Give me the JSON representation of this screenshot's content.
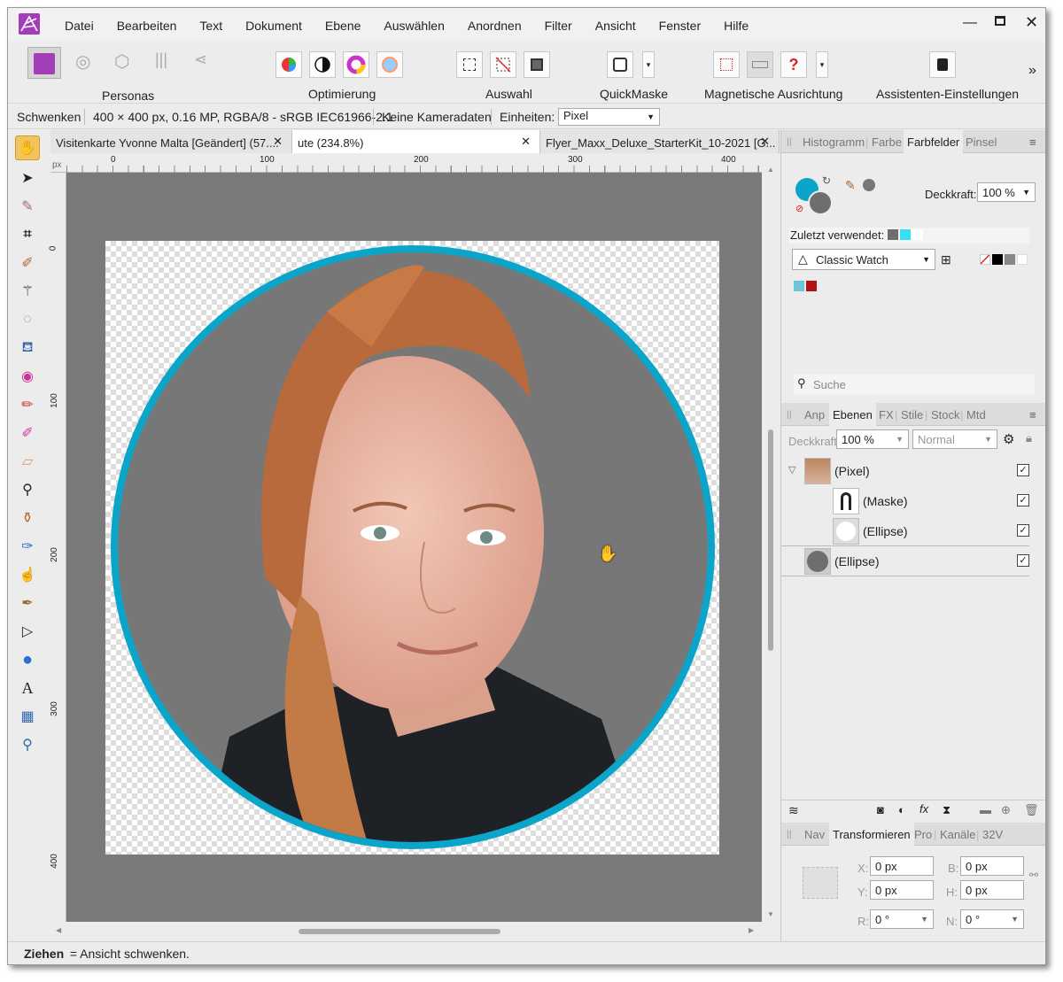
{
  "menu": [
    "Datei",
    "Bearbeiten",
    "Text",
    "Dokument",
    "Ebene",
    "Auswählen",
    "Anordnen",
    "Filter",
    "Ansicht",
    "Fenster",
    "Hilfe"
  ],
  "toolbar": {
    "personas": "Personas",
    "optimierung": "Optimierung",
    "auswahl": "Auswahl",
    "quickmaske": "QuickMaske",
    "magnet": "Magnetische Ausrichtung",
    "assist": "Assistenten-Einstellungen",
    "more": "»"
  },
  "context": {
    "tool": "Schwenken",
    "info": "400 × 400 px, 0.16 MP, RGBA/8 - sRGB IEC61966-2.1",
    "camera": "Keine Kameradaten",
    "units_label": "Einheiten:",
    "units_value": "Pixel"
  },
  "tabs": [
    {
      "label": "Visitenkarte Yvonne Malta [Geändert] (57...."
    },
    {
      "label": "ute (234.8%)"
    },
    {
      "label": "Flyer_Maxx_Deluxe_StarterKit_10-2021 [G..."
    }
  ],
  "ruler": {
    "unit": "px",
    "h": [
      "0",
      "100",
      "200",
      "300",
      "400"
    ],
    "v": [
      "0",
      "100",
      "200",
      "300",
      "400"
    ]
  },
  "status": {
    "bold": "Ziehen",
    "rest": " = Ansicht schwenken."
  },
  "colors": {
    "accent": "#0aa5c8",
    "canvas": "#7a7a7a",
    "circle_gray": "#777777"
  },
  "panel1": {
    "tabs": [
      "Histogramm",
      "Farbe",
      "Farbfelder",
      "Pinsel"
    ],
    "opacity_label": "Deckkraft:",
    "opacity_value": "100 %",
    "recent_label": "Zuletzt verwendet:",
    "palette": "Classic Watch",
    "search": "Suche"
  },
  "panel2": {
    "tabs": [
      "Anp",
      "Ebenen",
      "FX",
      "Stile",
      "Stock",
      "Mtd"
    ],
    "opacity_label": "Deckkraft:",
    "opacity_value": "100 %",
    "blend": "Normal",
    "layers": [
      {
        "name": "(Pixel)"
      },
      {
        "name": "(Maske)"
      },
      {
        "name": "(Ellipse)"
      },
      {
        "name": "(Ellipse)"
      }
    ]
  },
  "panel3": {
    "tabs": [
      "Nav",
      "Transformieren",
      "Pro",
      "Kanäle",
      "32V"
    ],
    "x_label": "X:",
    "x": "0 px",
    "y_label": "Y:",
    "y": "0 px",
    "b_label": "B:",
    "b": "0 px",
    "h_label": "H:",
    "h": "0 px",
    "r_label": "R:",
    "r": "0 °",
    "n_label": "N:",
    "n": "0 °"
  }
}
